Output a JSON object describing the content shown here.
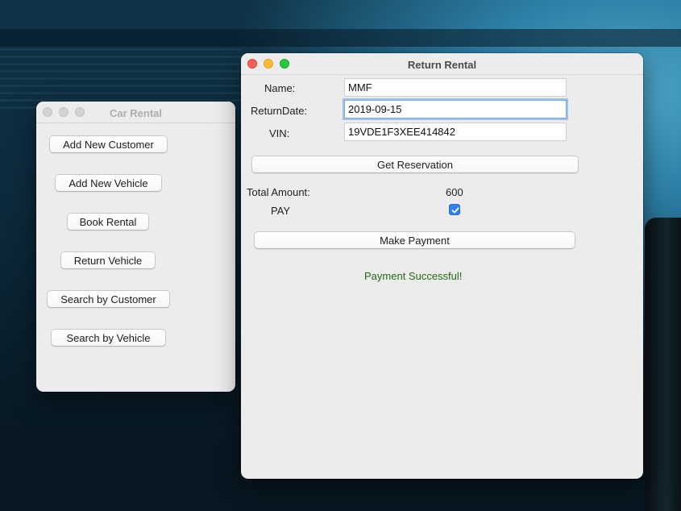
{
  "car_window": {
    "title": "Car Rental",
    "buttons": [
      "Add New Customer",
      "Add New Vehicle",
      "Book Rental",
      "Return Vehicle",
      "Search by Customer",
      "Search by Vehicle"
    ]
  },
  "return_window": {
    "title": "Return Rental",
    "name_label": "Name:",
    "name_value": "MMF",
    "return_date_label": "ReturnDate:",
    "return_date_value": "2019-09-15",
    "vin_label": "VIN:",
    "vin_value": "19VDE1F3XEE414842",
    "get_reservation_label": "Get Reservation",
    "total_amount_label": "Total Amount:",
    "total_amount_value": "600",
    "pay_label": "PAY",
    "pay_checked": true,
    "make_payment_label": "Make Payment",
    "status_message": "Payment Successful!"
  },
  "colors": {
    "checkbox_accent": "#2f7ff5",
    "success_text": "#226b12",
    "close": "#fe5f57",
    "minimize": "#febc2e",
    "zoom": "#28c840"
  }
}
